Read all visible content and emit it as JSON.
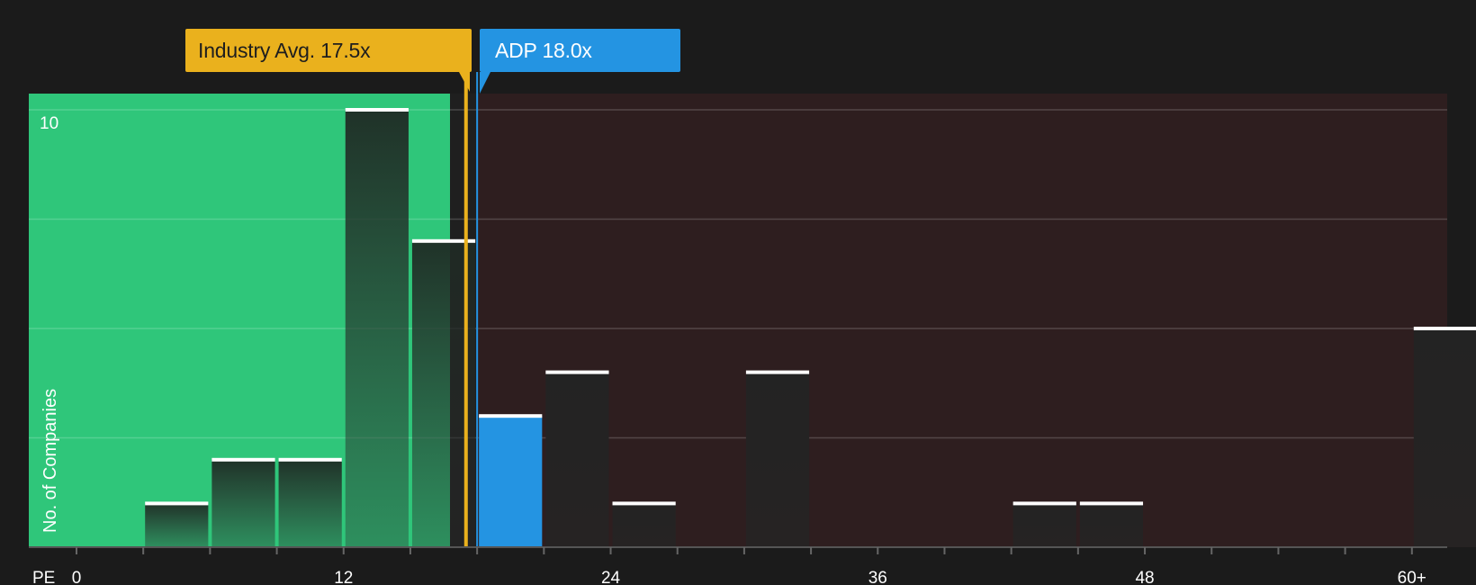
{
  "colors": {
    "background": "#1b1b1b",
    "below_region": "#2fc67a",
    "above_region": "#2e1e1f",
    "industry_line": "#eab11d",
    "company_bar": "#2494e2",
    "bar_cap": "#ffffff"
  },
  "labels": {
    "industry_avg": "Industry Avg. 17.5x",
    "company": "ADP 18.0x"
  },
  "chart_data": {
    "type": "bar",
    "title": "",
    "xlabel": "PE",
    "ylabel": "No. of Companies",
    "xlim": [
      -3,
      61.5
    ],
    "ylim": [
      0,
      10.4
    ],
    "bin_width": 3,
    "x_ticks": [
      0,
      12,
      24,
      36,
      48,
      60
    ],
    "x_tick_labels": [
      "0",
      "12",
      "24",
      "36",
      "48",
      "60+"
    ],
    "y_ticks": [
      10
    ],
    "y_gridlines": [
      2.5,
      5,
      7.5,
      10
    ],
    "industry_avg": 17.5,
    "company_value": 18.0,
    "company_name": "ADP",
    "bins": [
      {
        "x0": 3,
        "x1": 6,
        "count": 1
      },
      {
        "x0": 6,
        "x1": 9,
        "count": 2
      },
      {
        "x0": 9,
        "x1": 12,
        "count": 2
      },
      {
        "x0": 12,
        "x1": 15,
        "count": 10
      },
      {
        "x0": 15,
        "x1": 18,
        "count": 7
      },
      {
        "x0": 18,
        "x1": 21,
        "count": 3,
        "highlight": true
      },
      {
        "x0": 21,
        "x1": 24,
        "count": 4
      },
      {
        "x0": 24,
        "x1": 27,
        "count": 1
      },
      {
        "x0": 30,
        "x1": 33,
        "count": 4
      },
      {
        "x0": 42,
        "x1": 45,
        "count": 1
      },
      {
        "x0": 45,
        "x1": 48,
        "count": 1
      },
      {
        "x0": 60,
        "x1": 63,
        "count": 5
      }
    ]
  }
}
